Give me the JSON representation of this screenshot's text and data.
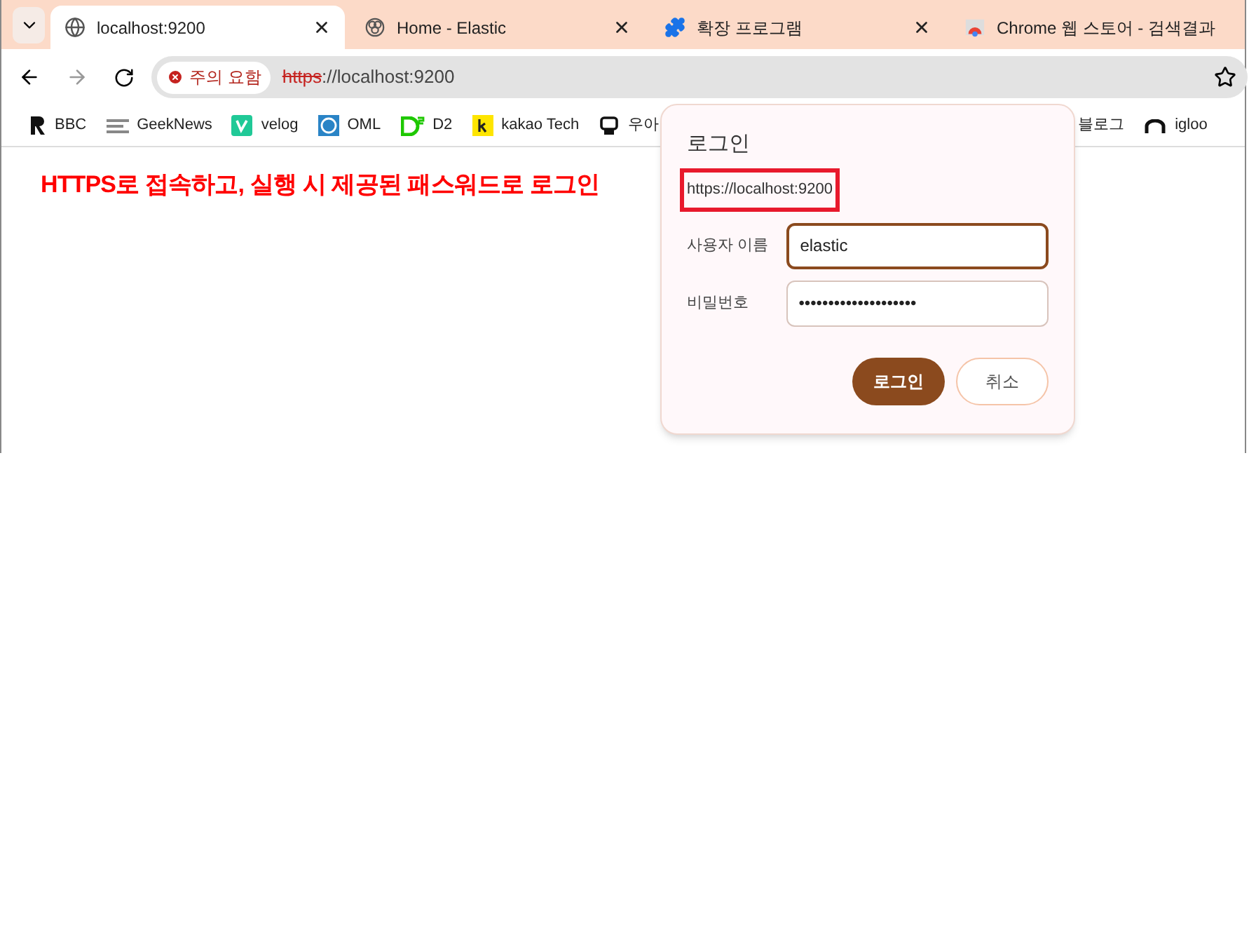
{
  "tabs": [
    {
      "title": "localhost:9200",
      "selected": true,
      "closable": true
    },
    {
      "title": "Home - Elastic",
      "selected": false,
      "closable": true
    },
    {
      "title": "확장 프로그램",
      "selected": false,
      "closable": true
    },
    {
      "title": "Chrome 웹 스토어 - 검색결과",
      "selected": false,
      "closable": false
    }
  ],
  "address_bar": {
    "security_label": "주의 요함",
    "scheme": "https",
    "rest": "://localhost:9200"
  },
  "bookmarks": [
    {
      "label": "BBC"
    },
    {
      "label": "GeekNews"
    },
    {
      "label": "velog"
    },
    {
      "label": "OML"
    },
    {
      "label": "D2"
    },
    {
      "label": "kakao Tech"
    },
    {
      "label": "우아"
    },
    {
      "label": "블로그"
    },
    {
      "label": "igloo"
    }
  ],
  "annotation": "HTTPS로 접속하고, 실행 시 제공된 패스워드로 로그인",
  "dialog": {
    "title": "로그인",
    "origin": "https://localhost:9200",
    "origin_highlighted": true,
    "fields": [
      {
        "label": "사용자 이름",
        "value": "elastic",
        "focused": true
      },
      {
        "label": "비밀번호",
        "value": "••••••••••••••••••••",
        "focused": false
      }
    ],
    "buttons": [
      {
        "label": "로그인",
        "kind": "primary"
      },
      {
        "label": "취소",
        "kind": "secondary"
      }
    ]
  }
}
